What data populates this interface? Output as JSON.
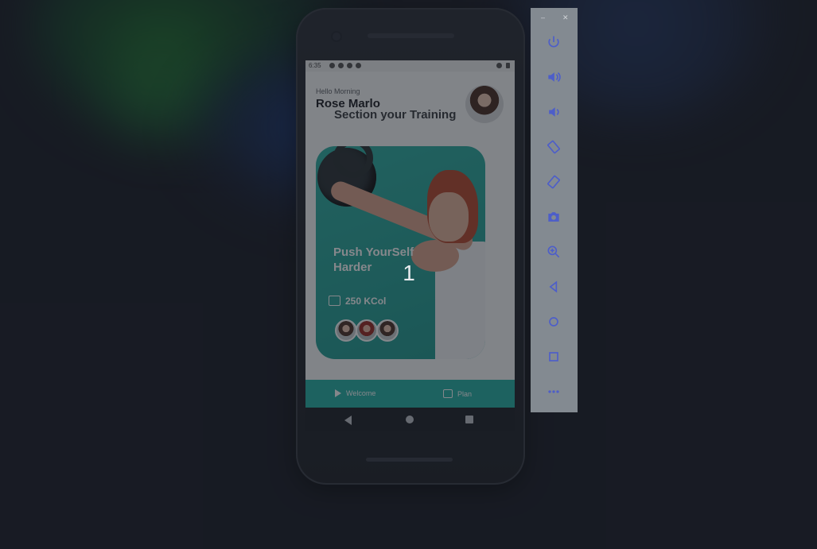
{
  "app": {
    "greeting": "Hello Morning",
    "user_name": "Rose Marlo",
    "subtitle": "Section your Training",
    "card": {
      "title": "Push YourSelf Harder",
      "calories": "250 KCol"
    },
    "bottom_nav": [
      {
        "label": "Welcome",
        "icon": "play-icon"
      },
      {
        "label": "Plan",
        "icon": "calendar-icon"
      }
    ],
    "status_bar": {
      "time": "6:35"
    }
  },
  "overlay": {
    "number": "1"
  },
  "emulator_toolbar": {
    "minimize": "–",
    "close": "✕",
    "buttons": [
      "power-icon",
      "volume-up-icon",
      "volume-down-icon",
      "rotate-left-icon",
      "rotate-right-icon",
      "camera-icon",
      "zoom-icon",
      "back-icon",
      "home-icon",
      "overview-icon",
      "more-icon"
    ],
    "icon_color": "#4d5ec9"
  },
  "colors": {
    "accent_teal": "#26b1a6",
    "background": "#1b1e27"
  }
}
